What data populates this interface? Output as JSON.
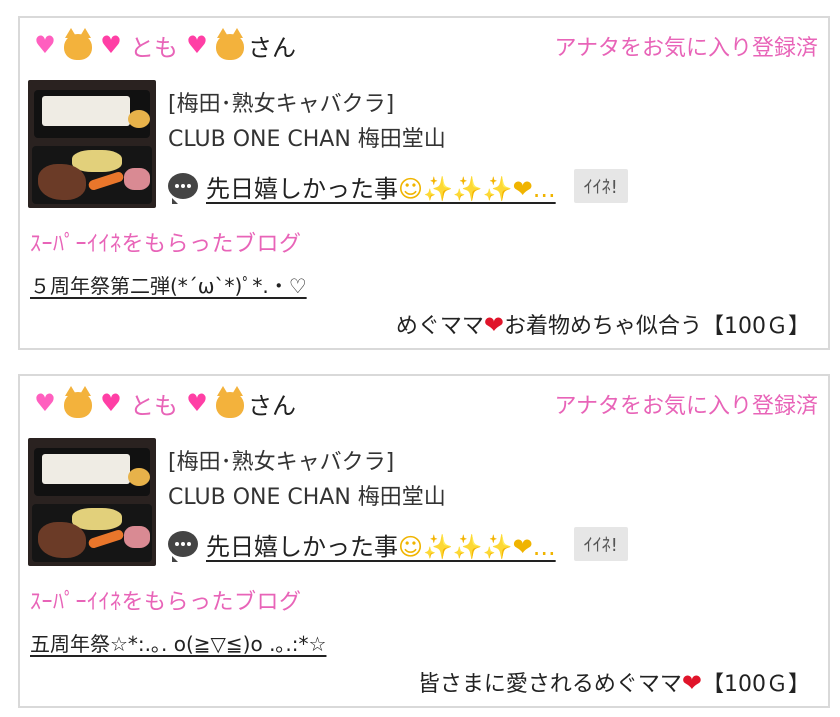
{
  "colors": {
    "accent_pink": "#e864b8",
    "iine_bg": "#e6e6e6",
    "heart_red": "#e0142a"
  },
  "cards": [
    {
      "user": {
        "name": "とも",
        "suffix": "さん",
        "icons": [
          "pink-heart-icon",
          "cat-icon",
          "sparkling-heart-icon",
          "sparkling-heart-icon",
          "cat-icon"
        ]
      },
      "favorite_status": "アナタをお気に入り登録済",
      "shop": {
        "category": "[梅田･熟女キャバクラ]",
        "name": "CLUB ONE CHAN 梅田堂山"
      },
      "blog": {
        "title_text": "先日嬉しかった事",
        "title_deco": "☺✨✨✨❤︎...",
        "iine_label": "ｲｲﾈ!"
      },
      "super_label": "ｽｰﾊﾟｰｲｲﾈをもらったブログ",
      "super_blog": "５周年祭第二弾(*´ω`*)ﾟ*.・♡",
      "comment": {
        "before": "めぐママ",
        "after": "お着物めちゃ似合う【100Ｇ】"
      }
    },
    {
      "user": {
        "name": "とも",
        "suffix": "さん",
        "icons": [
          "pink-heart-icon",
          "cat-icon",
          "sparkling-heart-icon",
          "sparkling-heart-icon",
          "cat-icon"
        ]
      },
      "favorite_status": "アナタをお気に入り登録済",
      "shop": {
        "category": "[梅田･熟女キャバクラ]",
        "name": "CLUB ONE CHAN 梅田堂山"
      },
      "blog": {
        "title_text": "先日嬉しかった事",
        "title_deco": "☺✨✨✨❤︎...",
        "iine_label": "ｲｲﾈ!"
      },
      "super_label": "ｽｰﾊﾟｰｲｲﾈをもらったブログ",
      "super_blog": "五周年祭☆*:.｡. o(≧▽≦)o .｡.:*☆",
      "comment": {
        "before": "皆さまに愛されるめぐママ",
        "after": "【100Ｇ】"
      }
    }
  ]
}
